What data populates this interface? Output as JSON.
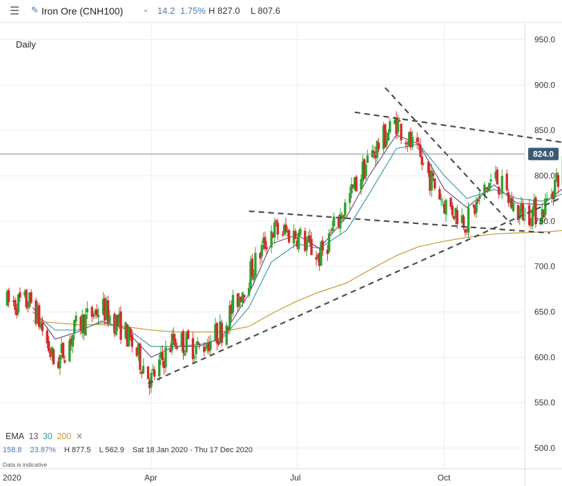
{
  "header": {
    "menu_icon": "hamburger-menu-icon",
    "edit_icon": "pencil-icon",
    "symbol": "Iron Ore (CNH100)",
    "dropdown_icon": "chevron-down-icon",
    "change": "14.2",
    "change_pct": "1.75%",
    "high": "H 827.0",
    "low": "L 807.6",
    "accent": "#4a7ab8"
  },
  "interval_label": "Daily",
  "legend": {
    "ema_label": "EMA",
    "ema_periods": [
      "13",
      "30",
      "200"
    ],
    "ema_colors": [
      "#6e4f82",
      "#3e98a8",
      "#c8962c"
    ],
    "close_icon": "close-x-icon",
    "range": "158.8",
    "range_pct": "23.87%",
    "high": "H 877.5",
    "low": "L 562.9",
    "period": "Sat 18 Jan 2020 - Thu 17 Dec 2020",
    "note": "Data is indicative"
  },
  "chart_data": {
    "type": "line",
    "subtype": "candlestick with EMA overlays and drawn trendlines",
    "instrument": "Iron Ore (CNH100)",
    "interval": "Daily",
    "x": [
      "2020-01-18",
      "2020-02-01",
      "2020-02-15",
      "2020-03-01",
      "2020-03-15",
      "2020-04-01",
      "2020-04-15",
      "2020-05-01",
      "2020-05-15",
      "2020-06-01",
      "2020-06-15",
      "2020-07-01",
      "2020-07-15",
      "2020-08-01",
      "2020-08-15",
      "2020-09-01",
      "2020-09-15",
      "2020-10-01",
      "2020-10-15",
      "2020-11-01",
      "2020-11-15",
      "2020-12-01",
      "2020-12-17"
    ],
    "x_tick_labels": [
      "2020",
      "Apr",
      "Jul",
      "Oct"
    ],
    "series": [
      {
        "name": "Price",
        "values": [
          660,
          590,
          635,
          655,
          630,
          575,
          620,
          610,
          630,
          690,
          740,
          735,
          710,
          770,
          820,
          860,
          820,
          770,
          750,
          800,
          760,
          760,
          824
        ]
      },
      {
        "name": "13",
        "values": [
          655,
          620,
          628,
          640,
          632,
          600,
          612,
          612,
          622,
          670,
          725,
          735,
          720,
          755,
          800,
          845,
          835,
          785,
          765,
          790,
          770,
          768,
          790
        ]
      },
      {
        "name": "30",
        "values": [
          650,
          630,
          630,
          638,
          634,
          612,
          612,
          614,
          620,
          655,
          705,
          725,
          720,
          740,
          780,
          830,
          835,
          800,
          775,
          785,
          775,
          772,
          782
        ]
      },
      {
        "name": "200",
        "values": [
          640,
          638,
          636,
          636,
          634,
          630,
          628,
          628,
          628,
          634,
          648,
          662,
          672,
          682,
          696,
          712,
          722,
          728,
          732,
          736,
          737,
          738,
          740
        ]
      }
    ],
    "last_price": 824.0,
    "last_price_label": "824.0",
    "y_tick_labels": [
      "950.0",
      "900.0",
      "850.0",
      "800.0",
      "750.0",
      "700.0",
      "650.0",
      "600.0",
      "550.0",
      "500.0"
    ],
    "ylim": [
      490,
      987
    ],
    "grid": true,
    "colors": {
      "up": "#2fa02f",
      "down": "#d42a2a",
      "trendline": "#4a4a4a",
      "price_tag": "#3a5a74"
    }
  }
}
